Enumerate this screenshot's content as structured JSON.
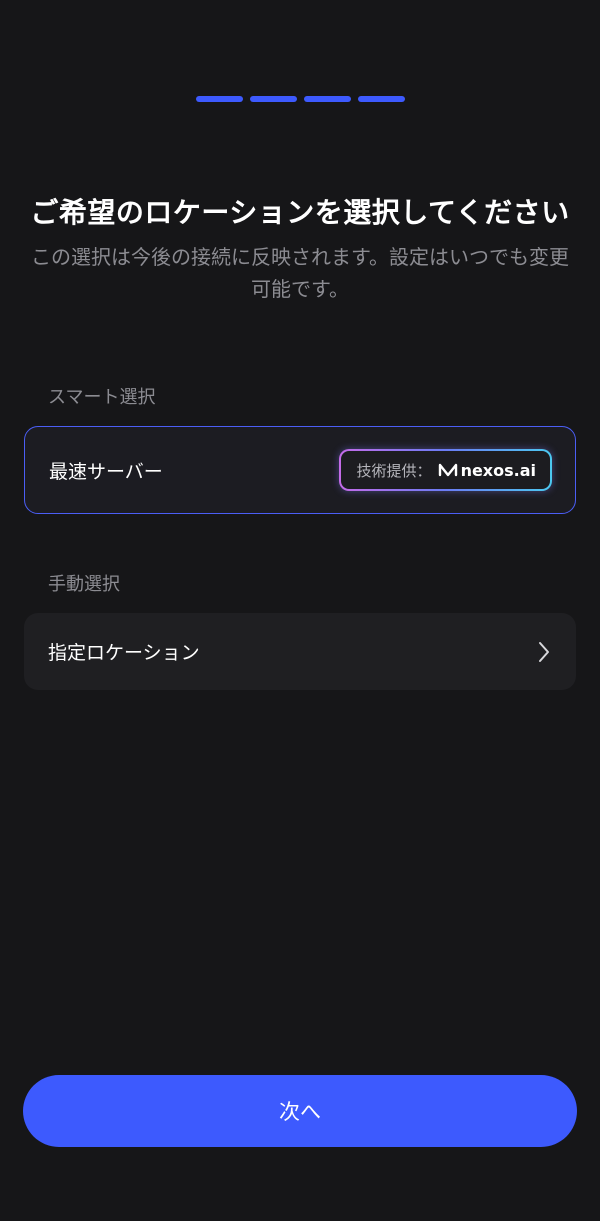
{
  "progress": {
    "steps": 4,
    "current": 4
  },
  "header": {
    "title": "ご希望のロケーションを選択してください",
    "subtitle": "この選択は今後の接続に反映されます。設定はいつでも変更可能です。"
  },
  "smart_section": {
    "label": "スマート選択",
    "option": {
      "label": "最速サーバー",
      "selected": true,
      "badge_prefix": "技術提供：",
      "badge_brand": "nexos.ai",
      "badge_icon": "nexos-logo-icon"
    }
  },
  "manual_section": {
    "label": "手動選択",
    "option": {
      "label": "指定ロケーション",
      "icon": "chevron-right-icon"
    }
  },
  "footer": {
    "next_label": "次へ"
  },
  "colors": {
    "background": "#161618",
    "accent": "#3d5afe",
    "card": "#1f1f22",
    "muted_text": "#8c8c92"
  }
}
